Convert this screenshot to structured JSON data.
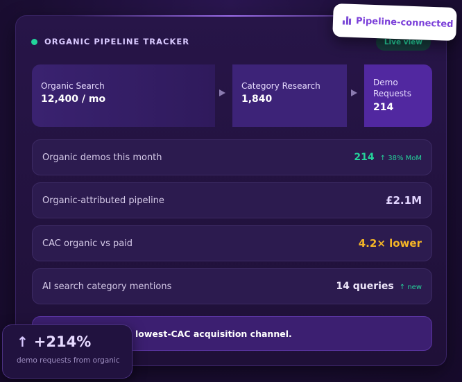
{
  "header": {
    "title": "ORGANIC PIPELINE TRACKER",
    "live_label": "Live view"
  },
  "badge": {
    "label": "Pipeline-connected",
    "icon": "bar-chart-icon"
  },
  "funnel": [
    {
      "label": "Organic Search",
      "value": "12,400 / mo"
    },
    {
      "label": "Category Research",
      "value": "1,840"
    },
    {
      "label": "Demo Requests",
      "value": "214"
    }
  ],
  "metrics": [
    {
      "label": "Organic demos this month",
      "value": "214",
      "note": "↑ 38% MoM"
    },
    {
      "label": "Organic-attributed pipeline",
      "value": "£2.1M"
    },
    {
      "label": "CAC organic vs paid",
      "value": "4.2× lower"
    },
    {
      "label": "AI search category mentions",
      "value": "14 queries",
      "note": "↑ new"
    }
  ],
  "banner": {
    "text": "lowest-CAC acquisition channel."
  },
  "stat": {
    "value": "+214%",
    "caption": "demo requests from organic"
  },
  "colors": {
    "accent_green": "#22d39b",
    "accent_gold": "#f5b526",
    "accent_purple": "#7b3fd9",
    "background": "#1d0f38"
  }
}
